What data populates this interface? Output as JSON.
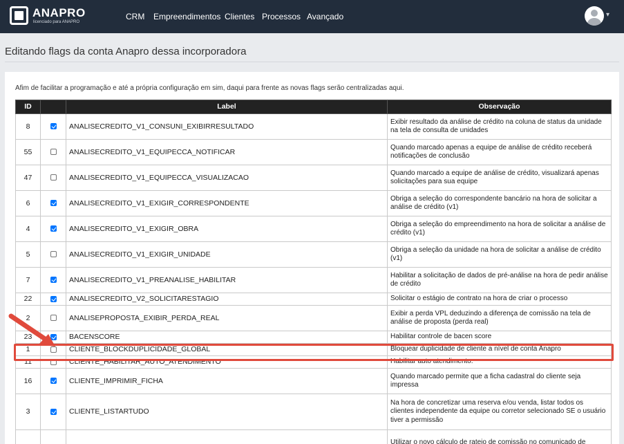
{
  "header": {
    "logo_name": "ANAPRO",
    "logo_sub": "licenciado para ANAPRO",
    "nav": [
      "CRM",
      "Empreendimentos",
      "Clientes",
      "Processos",
      "Avançado"
    ]
  },
  "page": {
    "title": "Editando flags da conta Anapro dessa incorporadora",
    "intro": "Afim de facilitar a programação e até a própria configuração em sim, daqui para frente as novas flags serão centralizadas aqui."
  },
  "table": {
    "columns": [
      "ID",
      "",
      "Label",
      "Observação"
    ],
    "rows": [
      {
        "id": "8",
        "checked": true,
        "label": "ANALISECREDITO_V1_CONSUNI_EXIBIRRESULTADO",
        "obs": "Exibir resultado da análise de crédito na coluna de status da unidade na tela de consulta de unidades"
      },
      {
        "id": "55",
        "checked": false,
        "label": "ANALISECREDITO_V1_EQUIPECCA_NOTIFICAR",
        "obs": "Quando marcado apenas a equipe de análise de crédito receberá notificações de conclusão"
      },
      {
        "id": "47",
        "checked": false,
        "label": "ANALISECREDITO_V1_EQUIPECCA_VISUALIZACAO",
        "obs": "Quando marcado a equipe de análise de crédito, visualizará apenas solicitações para sua equipe"
      },
      {
        "id": "6",
        "checked": true,
        "label": "ANALISECREDITO_V1_EXIGIR_CORRESPONDENTE",
        "obs": "Obriga a seleção do correspondente bancário na hora de solicitar a análise de crédito (v1)"
      },
      {
        "id": "4",
        "checked": true,
        "label": "ANALISECREDITO_V1_EXIGIR_OBRA",
        "obs": "Obriga a seleção do empreendimento na hora de solicitar a análise de crédito (v1)"
      },
      {
        "id": "5",
        "checked": false,
        "label": "ANALISECREDITO_V1_EXIGIR_UNIDADE",
        "obs": "Obriga a seleção da unidade na hora de solicitar a análise de crédito (v1)"
      },
      {
        "id": "7",
        "checked": true,
        "label": "ANALISECREDITO_V1_PREANALISE_HABILITAR",
        "obs": "Habilitar a solicitação de dados de pré-análise na hora de pedir análise de crédito"
      },
      {
        "id": "22",
        "checked": true,
        "label": "ANALISECREDITO_V2_SOLICITARESTAGIO",
        "obs": "Solicitar o estágio de contrato na hora de criar o processo"
      },
      {
        "id": "2",
        "checked": false,
        "label": "ANALISEPROPOSTA_EXIBIR_PERDA_REAL",
        "obs": "Exibir a perda VPL deduzindo a diferença de comissão na tela de análise de proposta (perda real)"
      },
      {
        "id": "23",
        "checked": true,
        "label": "BACENSCORE",
        "obs": "Habilitar controle de bacen score"
      },
      {
        "id": "1",
        "checked": false,
        "label": "CLIENTE_BLOCKDUPLICIDADE_GLOBAL",
        "obs": "Bloquear duplicidade de cliente a nível de conta Anapro"
      },
      {
        "id": "11",
        "checked": false,
        "label": "CLIENTE_HABILITAR_AUTO_ATENDIMENTO",
        "obs": "Habilitar auto atendimento."
      },
      {
        "id": "16",
        "checked": true,
        "label": "CLIENTE_IMPRIMIR_FICHA",
        "obs": "Quando marcado permite que a ficha cadastral do cliente seja impressa"
      },
      {
        "id": "3",
        "checked": true,
        "label": "CLIENTE_LISTARTUDO",
        "obs": "Na hora de concretizar uma reserva e/ou venda, listar todos os clientes independente da equipe ou corretor selecionado SE o usuário tiver a permissão"
      },
      {
        "id": "",
        "checked": false,
        "label": "",
        "obs": "Utilizar o novo cálculo de rateio de comissão no comunicado de"
      }
    ]
  },
  "colors": {
    "navbar": "#222d3c",
    "header_row": "#222222",
    "highlight": "#e04a3c",
    "checkbox_on": "#0075ff"
  }
}
